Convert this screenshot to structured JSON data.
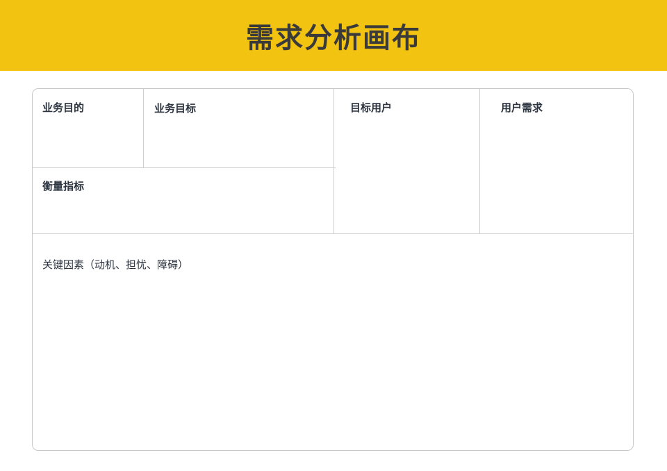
{
  "header": {
    "title": "需求分析画布",
    "background_color": "#F2C311"
  },
  "canvas": {
    "business_purpose": "业务目的",
    "business_goal": "业务目标",
    "target_users": "目标用户",
    "user_needs": "用户需求",
    "metrics": "衡量指标",
    "key_factors": "关键因素（动机、担忧、障碍）"
  }
}
